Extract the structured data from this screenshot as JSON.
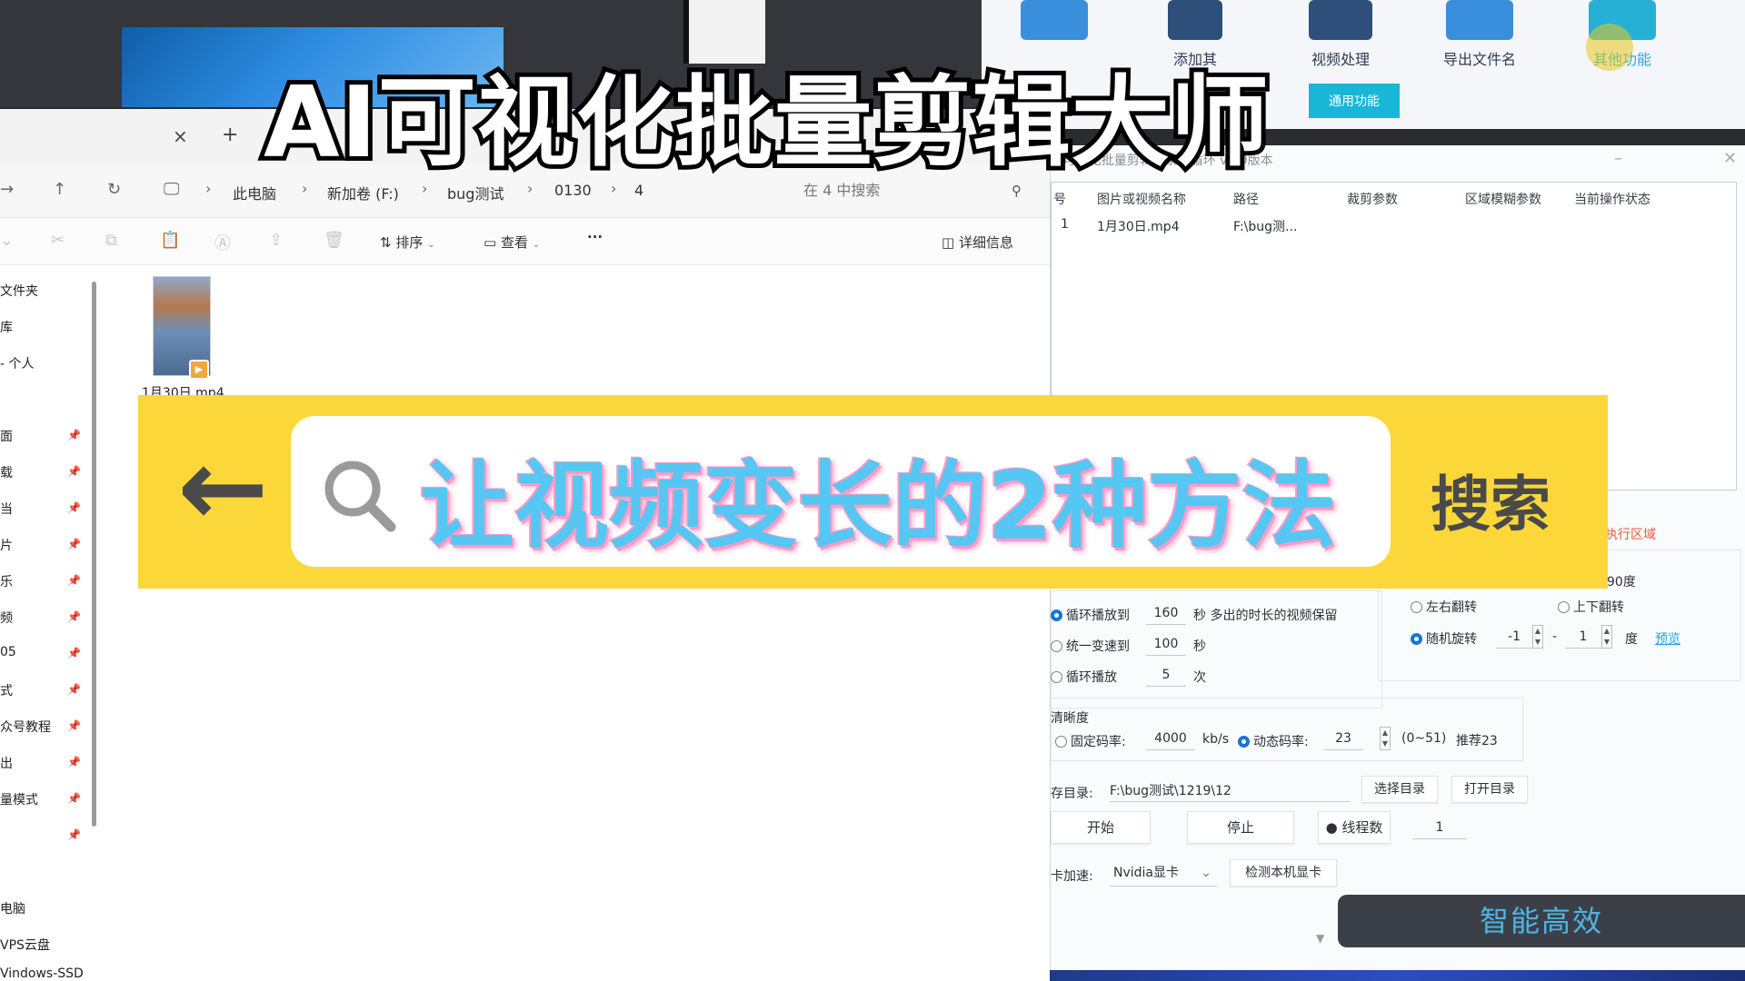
{
  "overlay": {
    "title": "AI可视化批量剪辑大师",
    "search_text": "让视频变长的2种方法",
    "search_button": "搜索"
  },
  "editor": {
    "toolbar": [
      "添加其",
      "视频处理",
      "导出文件名",
      "其他功能"
    ],
    "general_button": "通用功能",
    "window_title": "AI可视化批量剪辑 - 素材循环 v8.9版本",
    "table_headers": [
      "号",
      "图片或视频名称",
      "路径",
      "裁剪参数",
      "区域模糊参数",
      "当前操作状态"
    ],
    "table_rows": [
      {
        "no": "1",
        "name": "1月30日.mp4",
        "path": "F:\\bug测..."
      }
    ],
    "exec_area": "执行区域",
    "degree_label": "90度",
    "flip_lr": "左右翻转",
    "flip_ud": "上下翻转",
    "random_rotate": "随机旋转",
    "rotate_min": "-1",
    "rotate_dash": "-",
    "rotate_max": "1",
    "degree_unit": "度",
    "preview": "预览",
    "loop_to": "循环播放到",
    "loop_to_value": "160",
    "loop_to_suffix": "秒 多出的时长的视频保留",
    "speed_to": "统一变速到",
    "speed_to_value": "100",
    "speed_to_suffix": "秒",
    "loop_play": "循环播放",
    "loop_play_value": "5",
    "loop_play_suffix": "次",
    "clarity": "清晰度",
    "fixed_bitrate": "固定码率:",
    "fixed_bitrate_value": "4000",
    "bitrate_unit": "kb/s",
    "dynamic_bitrate": "动态码率:",
    "dynamic_bitrate_value": "23",
    "bitrate_range": "(0~51)",
    "recommend": "推荐23",
    "save_dir_label": "存目录:",
    "save_dir_value": "F:\\bug测试\\1219\\12",
    "choose_dir": "选择目录",
    "open_dir": "打开目录",
    "start": "开始",
    "stop": "停止",
    "threads_label": "线程数",
    "threads_value": "1",
    "gpu_label": "卡加速:",
    "gpu_value": "Nvidia显卡",
    "detect_gpu": "检测本机显卡",
    "smart_banner": "智能高效"
  },
  "explorer": {
    "tab_close": "×",
    "tab_add": "+",
    "breadcrumb": [
      "此电脑",
      "新加卷 (F:)",
      "bug测试",
      "0130",
      "4"
    ],
    "search_placeholder": "在 4 中搜索",
    "sort": "排序",
    "view": "查看",
    "more": "···",
    "details": "详细信息",
    "nav_items": [
      "文件夹",
      "库",
      "- 个人",
      "面",
      "载",
      "当",
      "片",
      "乐",
      "频",
      "05",
      "式",
      "众号教程",
      "出",
      "量模式",
      "",
      "电脑",
      "VPS云盘",
      "Vindows-SSD"
    ],
    "file_name": "1月30日.mp4"
  }
}
